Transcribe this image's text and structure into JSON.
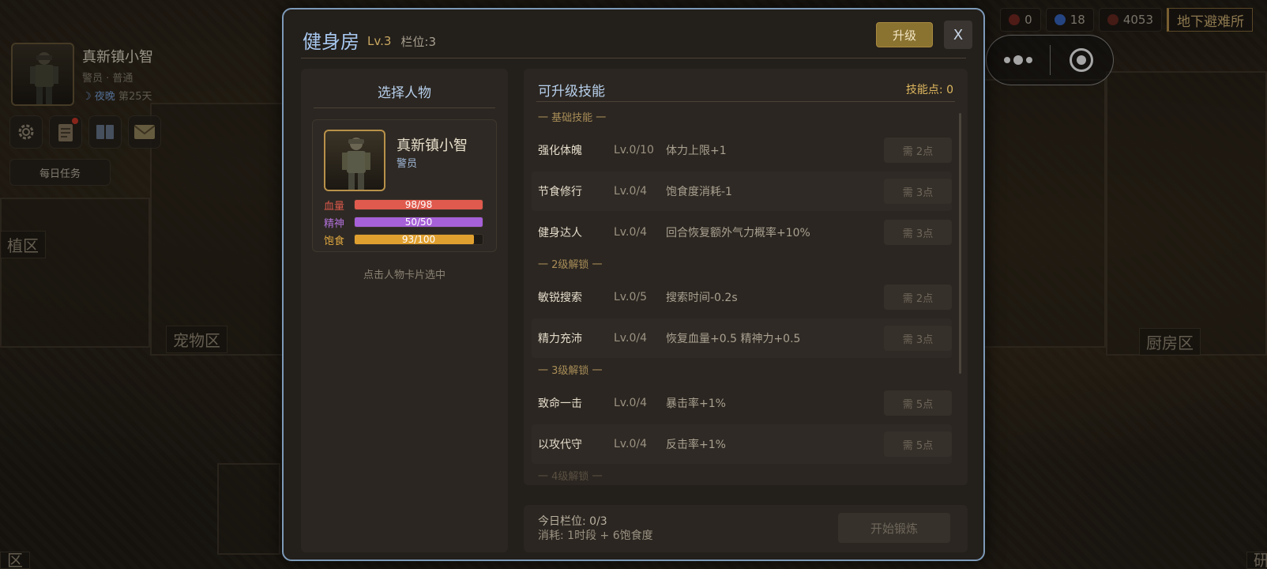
{
  "hud": {
    "player_name": "真新镇小智",
    "player_sub": "警员 · 普通",
    "time_of_day": "夜晚",
    "day": "第25天",
    "daily_task_label": "每日任务"
  },
  "resources": {
    "res1": "0",
    "res2": "18",
    "res3": "4053",
    "shelter_label": "地下避难所",
    "colors": {
      "res1": "#7a2a22",
      "res2": "#3a6ac8",
      "res3": "#6a2a22"
    }
  },
  "zones": {
    "zone_a": "植区",
    "pet": "宠物区",
    "kitchen": "厨房区",
    "bottom_left": "区",
    "bottom_right": "研"
  },
  "modal": {
    "title": "健身房",
    "level": "Lv.3",
    "slots": "栏位:3",
    "upgrade_label": "升级",
    "close_label": "X",
    "accent_color": "#7d9ab8"
  },
  "left_panel": {
    "title": "选择人物",
    "character": {
      "name": "真新镇小智",
      "role": "警员",
      "stats": [
        {
          "label": "血量",
          "text": "98/98",
          "value": 98,
          "max": 98,
          "color": "#e05a4e",
          "label_color": "#d8584a"
        },
        {
          "label": "精神",
          "text": "50/50",
          "value": 50,
          "max": 50,
          "color": "#a660d8",
          "label_color": "#b070d8"
        },
        {
          "label": "饱食",
          "text": "93/100",
          "value": 93,
          "max": 100,
          "color": "#e0a030",
          "label_color": "#e0a840"
        }
      ]
    },
    "hint": "点击人物卡片选中"
  },
  "right_panel": {
    "title": "可升级技能",
    "skill_points": "技能点: 0",
    "groups": [
      {
        "header": "一 基础技能 一",
        "skills": [
          {
            "name": "强化体魄",
            "level": "Lv.0/10",
            "effect": "体力上限+1",
            "cost": "需 2点"
          },
          {
            "name": "节食修行",
            "level": "Lv.0/4",
            "effect": "饱食度消耗-1",
            "cost": "需 3点"
          },
          {
            "name": "健身达人",
            "level": "Lv.0/4",
            "effect": "回合恢复额外气力概率+10%",
            "cost": "需 3点"
          }
        ]
      },
      {
        "header": "一 2级解锁 一",
        "skills": [
          {
            "name": "敏锐搜索",
            "level": "Lv.0/5",
            "effect": "搜索时间-0.2s",
            "cost": "需 2点"
          },
          {
            "name": "精力充沛",
            "level": "Lv.0/4",
            "effect": "恢复血量+0.5 精神力+0.5",
            "cost": "需 3点"
          }
        ]
      },
      {
        "header": "一 3级解锁 一",
        "skills": [
          {
            "name": "致命一击",
            "level": "Lv.0/4",
            "effect": "暴击率+1%",
            "cost": "需 5点"
          },
          {
            "name": "以攻代守",
            "level": "Lv.0/4",
            "effect": "反击率+1%",
            "cost": "需 5点"
          }
        ]
      }
    ],
    "next_group_header": "一 4级解锁 一"
  },
  "footer": {
    "slots_today": "今日栏位: 0/3",
    "cost": "消耗: 1时段 + 6饱食度",
    "start_label": "开始锻炼"
  }
}
